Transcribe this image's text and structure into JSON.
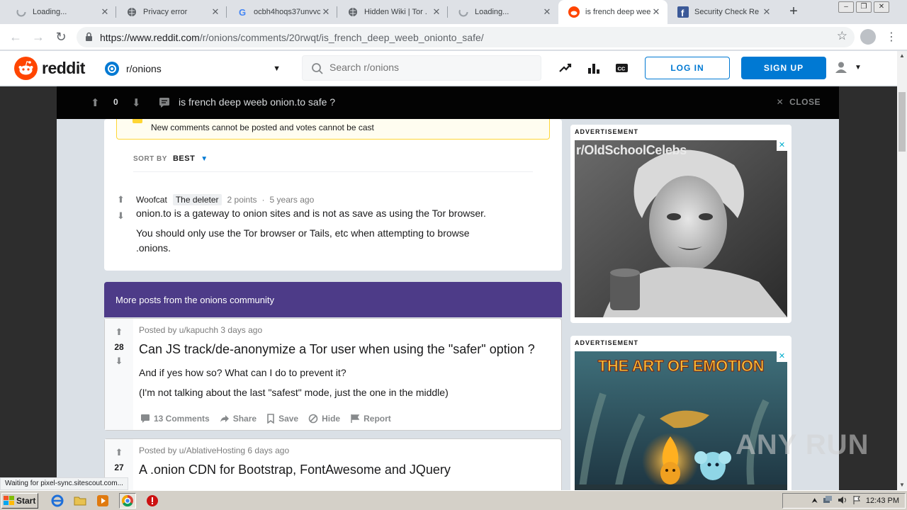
{
  "browser": {
    "tabs": [
      {
        "label": "Loading...",
        "icon": "loading-spinner-icon",
        "active": false
      },
      {
        "label": "Privacy error",
        "icon": "globe-icon",
        "active": false
      },
      {
        "label": "ocbh4hoqs37unvvc",
        "icon": "google-icon",
        "active": false
      },
      {
        "label": "Hidden Wiki | Tor .",
        "icon": "globe-icon",
        "active": false
      },
      {
        "label": "Loading...",
        "icon": "loading-spinner-icon",
        "active": false
      },
      {
        "label": "is french deep wee",
        "icon": "reddit-icon",
        "active": true
      },
      {
        "label": "Security Check Re",
        "icon": "facebook-icon",
        "active": false
      }
    ],
    "url_domain": "https://www.reddit.com",
    "url_path": "/r/onions/comments/20rwqt/is_french_deep_weeb_onionto_safe/",
    "status_text": "Waiting for pixel-sync.sitescout.com..."
  },
  "reddit": {
    "logo_text": "reddit",
    "community": "r/onions",
    "search_placeholder": "Search r/onions",
    "login_label": "LOG IN",
    "signup_label": "SIGN UP"
  },
  "postbar": {
    "score": "0",
    "title": "is french deep weeb onion.to safe ?",
    "close_label": "CLOSE"
  },
  "archived_notice": "New comments cannot be posted and votes cannot be cast",
  "sort": {
    "label": "SORT BY",
    "value": "BEST"
  },
  "comment": {
    "author": "Woofcat",
    "flair": "The deleter",
    "points": "2 points",
    "separator": "·",
    "age": "5 years ago",
    "paragraphs": [
      "onion.to is a gateway to onion sites and is not as save as using the Tor browser.",
      "You should only use the Tor browser or Tails, etc when attempting to browse",
      ".onions."
    ]
  },
  "more_posts": {
    "header": "More posts from the onions community",
    "posts": [
      {
        "score": "28",
        "meta": "Posted by u/kapuchh 3 days ago",
        "title": "Can JS track/de-anonymize a Tor user when using the \"safer\" option ?",
        "lines": [
          "And if yes how so? What can I do to prevent it?",
          "(I'm not talking about the last \"safest\" mode, just the one in the middle)"
        ],
        "actions": {
          "comments": "13 Comments",
          "share": "Share",
          "save": "Save",
          "hide": "Hide",
          "report": "Report"
        }
      },
      {
        "score": "27",
        "meta": "Posted by u/AblativeHosting 6 days ago",
        "title": "A .onion CDN for Bootstrap, FontAwesome and JQuery"
      }
    ]
  },
  "ads": [
    {
      "label": "ADVERTISEMENT",
      "headline": "r/OldSchoolCelebs",
      "close": "✕"
    },
    {
      "label": "ADVERTISEMENT",
      "headline": "THE ART OF EMOTION",
      "close": "✕"
    }
  ],
  "watermark": "ANY RUN",
  "taskbar": {
    "start_label": "Start",
    "clock": "12:43 PM"
  },
  "colors": {
    "reddit_orange": "#ff4500",
    "reddit_blue": "#0079d3",
    "community_purple": "#4d3b88",
    "postbar_black": "#030303"
  }
}
